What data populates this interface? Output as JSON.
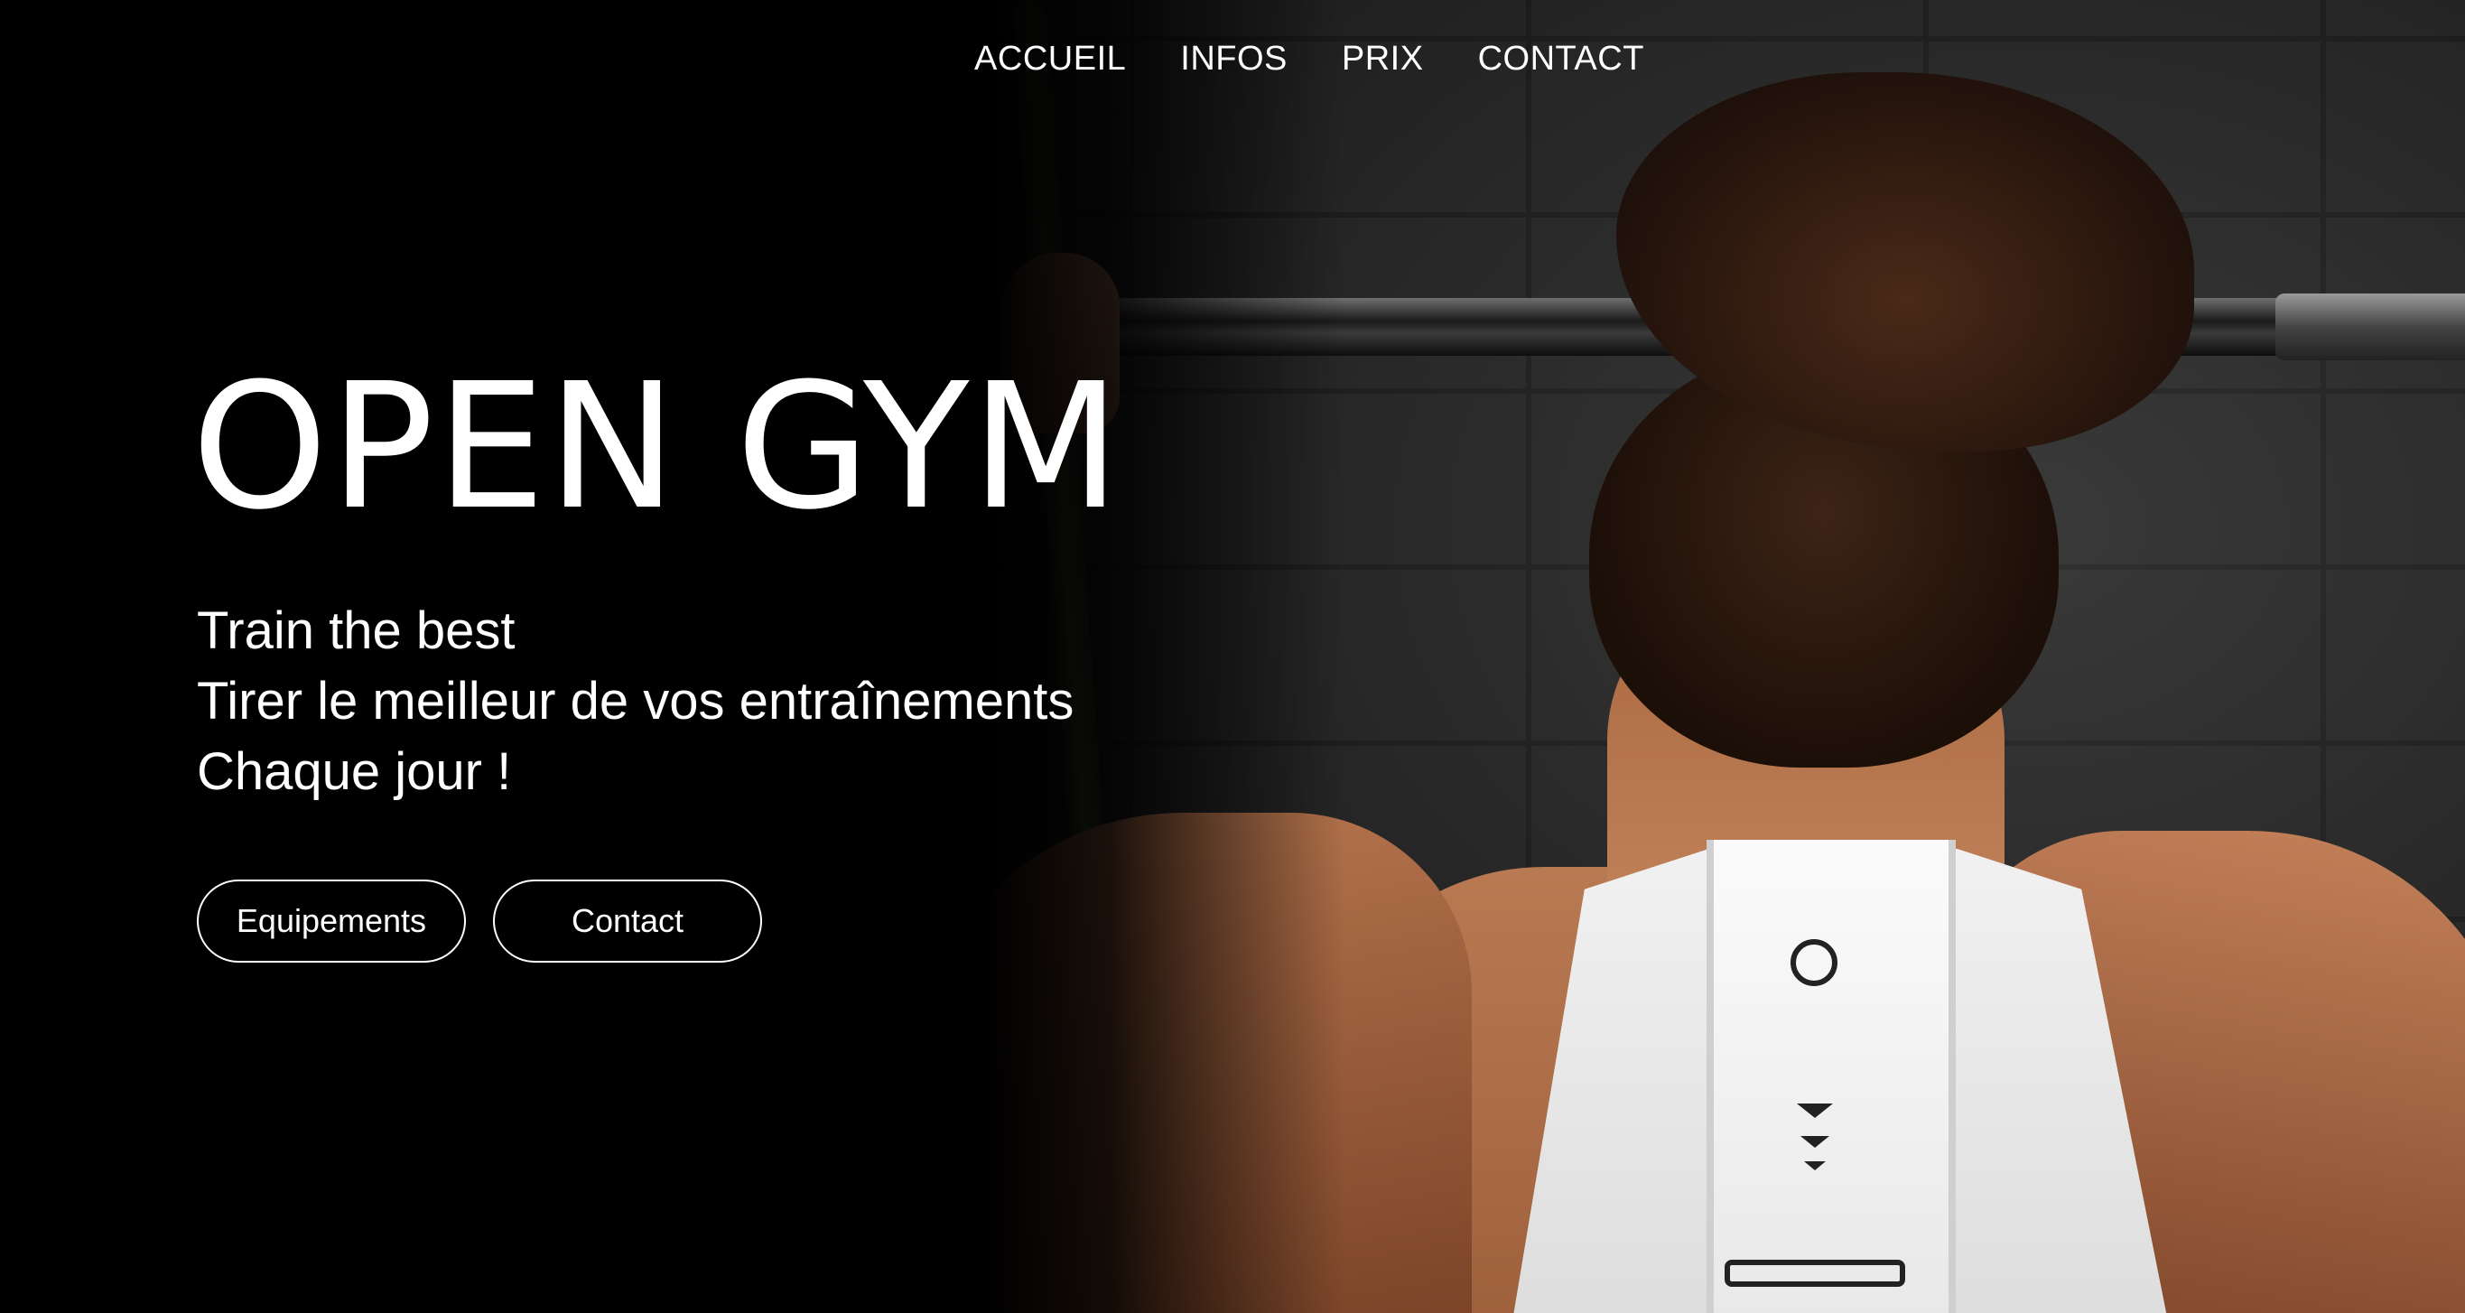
{
  "nav": {
    "items": [
      {
        "label": "ACCUEIL"
      },
      {
        "label": "INFOS"
      },
      {
        "label": "PRIX"
      },
      {
        "label": "CONTACT"
      }
    ]
  },
  "hero": {
    "title": "OPEN GYM",
    "lines": [
      "Train the best",
      "Tirer le meilleur de vos entraînements",
      "Chaque jour !"
    ],
    "buttons": {
      "equipements_label": "Equipements",
      "contact_label": "Contact"
    },
    "image": "woman-lifting-barbell-photo"
  },
  "colors": {
    "background": "#000000",
    "text": "#ffffff"
  }
}
